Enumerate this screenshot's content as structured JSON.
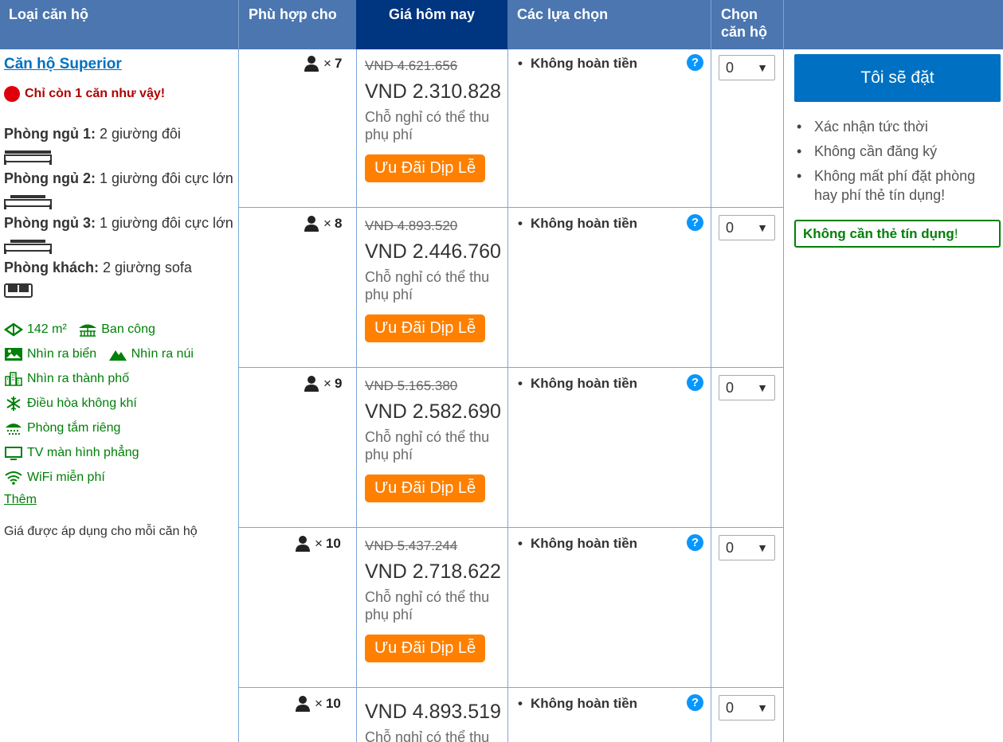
{
  "header": {
    "col_room": "Loại căn hộ",
    "col_fits": "Phù hợp cho",
    "col_price": "Giá hôm nay",
    "col_options": "Các lựa chọn",
    "col_select_1": "Chọn",
    "col_select_2": "căn hộ"
  },
  "room": {
    "name": "Căn hộ Superior",
    "scarcity": "Chỉ còn 1 căn như vậy!",
    "beds": [
      {
        "label": "Phòng ngủ 1:",
        "value": " 2 giường đôi"
      },
      {
        "label": "Phòng ngủ 2:",
        "value": " 1 giường đôi cực lớn"
      },
      {
        "label": "Phòng ngủ 3:",
        "value": " 1 giường đôi cực lớn"
      },
      {
        "label": "Phòng khách:",
        "value": " 2 giường sofa"
      }
    ],
    "area": "142 m²",
    "facilities": {
      "balcony": "Ban công",
      "sea_view": "Nhìn ra biển",
      "mountain_view": "Nhìn ra núi",
      "city_view": "Nhìn ra thành phố",
      "aircon": "Điều hòa không khí",
      "bathroom": "Phòng tắm riêng",
      "tv": "TV màn hình phẳng",
      "wifi": "WiFi miễn phí"
    },
    "more_link": "Thêm",
    "applied_note": "Giá được áp dụng cho mỗi căn hộ"
  },
  "rows": [
    {
      "guests": "7",
      "old_price": "VND 4.621.656",
      "price": "VND 2.310.828",
      "fee": "Chỗ nghỉ có thể thu phụ phí",
      "deal": "Ưu Đãi Dịp Lễ",
      "option": "Không hoàn tiền",
      "select": "0"
    },
    {
      "guests": "8",
      "old_price": "VND 4.893.520",
      "price": "VND 2.446.760",
      "fee": "Chỗ nghỉ có thể thu phụ phí",
      "deal": "Ưu Đãi Dịp Lễ",
      "option": "Không hoàn tiền",
      "select": "0"
    },
    {
      "guests": "9",
      "old_price": "VND 5.165.380",
      "price": "VND 2.582.690",
      "fee": "Chỗ nghỉ có thể thu phụ phí",
      "deal": "Ưu Đãi Dịp Lễ",
      "option": "Không hoàn tiền",
      "select": "0"
    },
    {
      "guests": "10",
      "old_price": "VND 5.437.244",
      "price": "VND 2.718.622",
      "fee": "Chỗ nghỉ có thể thu phụ phí",
      "deal": "Ưu Đãi Dịp Lễ",
      "option": "Không hoàn tiền",
      "select": "0"
    },
    {
      "guests": "10",
      "old_price": "",
      "price": "VND 4.893.519",
      "fee": "Chỗ nghỉ có thể thu",
      "deal": "",
      "option": "Không hoàn tiền",
      "select": "0"
    }
  ],
  "symbols": {
    "times": "×",
    "bullet": "•",
    "help": "?",
    "arrow": "▼"
  },
  "booking": {
    "button": "Tôi sẽ đặt",
    "benefits": [
      "Xác nhận tức thời",
      "Không cần đăng ký",
      "Không mất phí đặt phòng hay phí thẻ tín dụng!"
    ],
    "no_card": "Không cần thẻ tín dụng",
    "no_card_suffix": "!"
  },
  "colors": {
    "header": "#4b76b0",
    "price_header": "#003580",
    "book_button": "#0071c2",
    "deal": "#ff8000",
    "green": "#008009"
  }
}
